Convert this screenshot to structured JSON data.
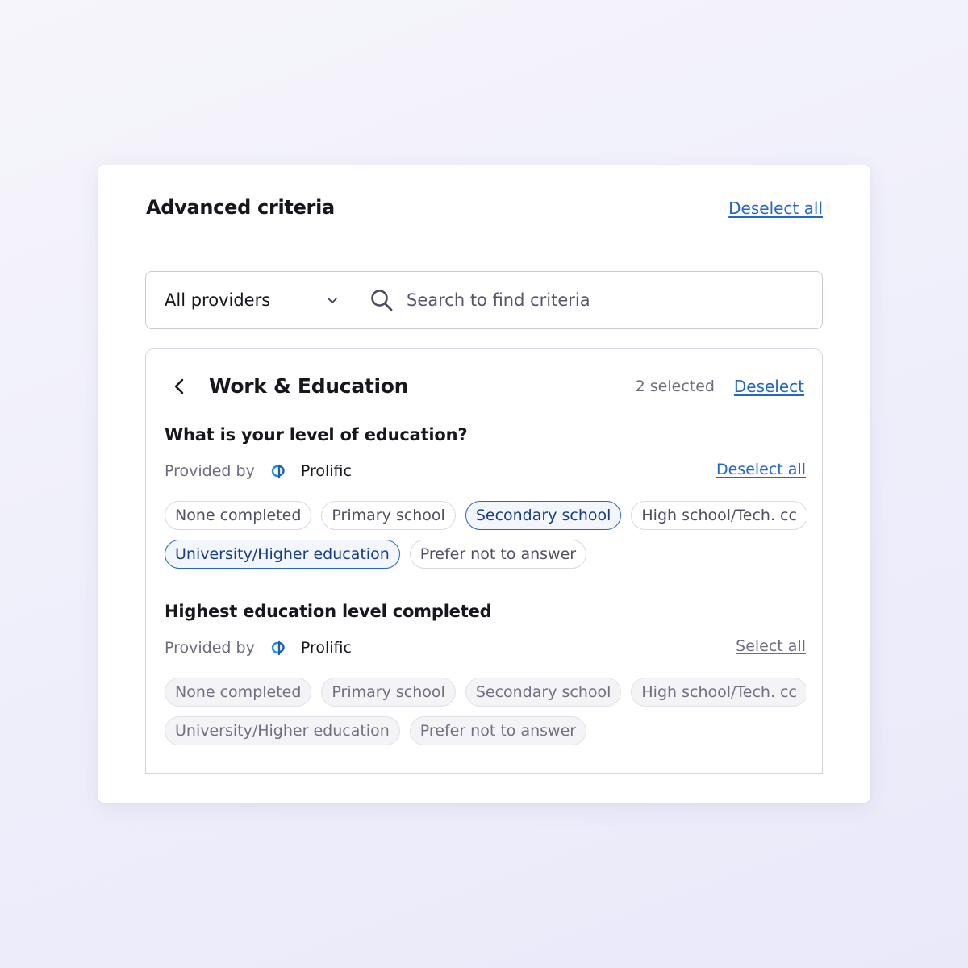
{
  "card": {
    "title": "Advanced criteria",
    "deselect_all_label": "Deselect all"
  },
  "filter": {
    "provider_selected": "All providers",
    "search_placeholder": "Search to find criteria"
  },
  "panel": {
    "title": "Work & Education",
    "selected_count": "2 selected",
    "deselect_label": "Deselect"
  },
  "questions": [
    {
      "title": "What is your level of education?",
      "provided_by_label": "Provided by",
      "provider_name": "Prolific",
      "action_label": "Deselect all",
      "options_row1": [
        {
          "label": "None completed",
          "selected": false
        },
        {
          "label": "Primary school",
          "selected": false
        },
        {
          "label": "Secondary school",
          "selected": true
        },
        {
          "label": "High school/Tech. cc",
          "selected": false
        }
      ],
      "options_row2": [
        {
          "label": "University/Higher education",
          "selected": true
        },
        {
          "label": "Prefer not to answer",
          "selected": false
        }
      ]
    },
    {
      "title": "Highest education level completed",
      "provided_by_label": "Provided by",
      "provider_name": "Prolific",
      "action_label": "Select all",
      "options_row1": [
        {
          "label": "None completed",
          "selected": false
        },
        {
          "label": "Primary school",
          "selected": false
        },
        {
          "label": "Secondary school",
          "selected": false
        },
        {
          "label": "High school/Tech. cc",
          "selected": false
        }
      ],
      "options_row2": [
        {
          "label": "University/Higher education",
          "selected": false
        },
        {
          "label": "Prefer not to answer",
          "selected": false
        }
      ]
    }
  ],
  "colors": {
    "link": "#2166c9",
    "selected_chip_border": "#2166c9",
    "muted_text": "#6c6d7e"
  },
  "icons": {
    "provider_dropdown": "chevron-down-icon",
    "search": "search-icon",
    "back": "chevron-left-icon",
    "provider_logo": "prolific-logo-icon"
  }
}
